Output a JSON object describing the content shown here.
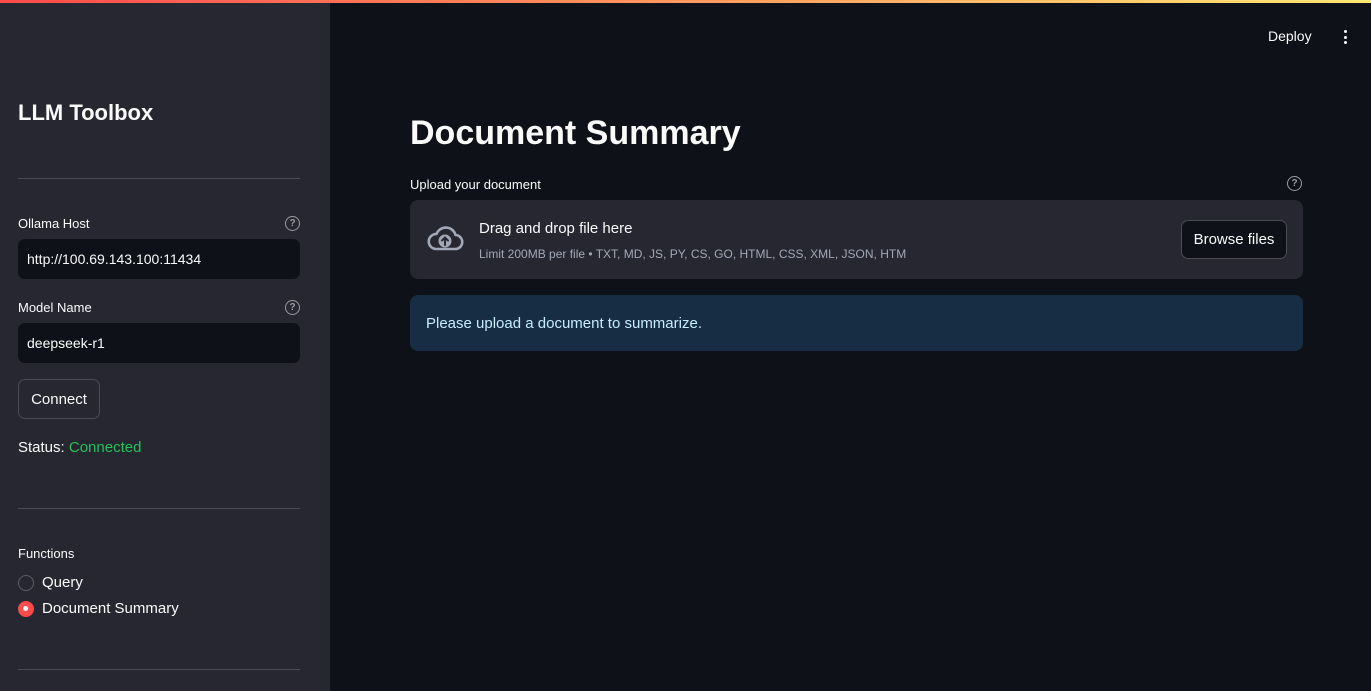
{
  "sidebar": {
    "app_title": "LLM Toolbox",
    "host": {
      "label": "Ollama Host",
      "value": "http://100.69.143.100:11434",
      "help_icon": "question-circle-icon"
    },
    "model": {
      "label": "Model Name",
      "value": "deepseek-r1",
      "help_icon": "question-circle-icon"
    },
    "connect_label": "Connect",
    "status": {
      "label": "Status:",
      "value": "Connected",
      "color": "#21c354"
    },
    "functions": {
      "label": "Functions",
      "options": [
        {
          "label": "Query",
          "selected": false
        },
        {
          "label": "Document Summary",
          "selected": true
        }
      ],
      "accent": "#ff4b4b"
    }
  },
  "header": {
    "deploy_label": "Deploy",
    "menu_icon": "kebab-menu-icon"
  },
  "main": {
    "title": "Document Summary",
    "uploader": {
      "label": "Upload your document",
      "help_icon": "question-circle-icon",
      "icon": "cloud-upload-icon",
      "title": "Drag and drop file here",
      "subtitle": "Limit 200MB per file • TXT, MD, JS, PY, CS, GO, HTML, CSS, XML, JSON, HTM",
      "browse_label": "Browse files"
    },
    "info_message": "Please upload a document to summarize."
  }
}
